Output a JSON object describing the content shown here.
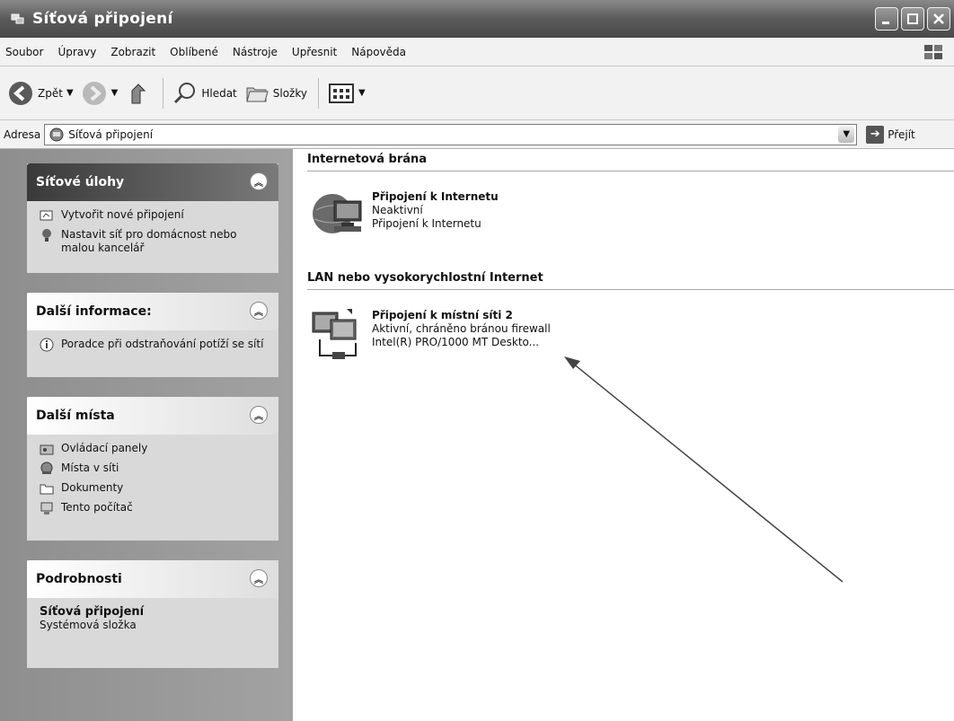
{
  "window": {
    "title": "Síťová připojení"
  },
  "menu": {
    "items": [
      "Soubor",
      "Úpravy",
      "Zobrazit",
      "Oblíbené",
      "Nástroje",
      "Upřesnit",
      "Nápověda"
    ]
  },
  "toolbar": {
    "back_label": "Zpět",
    "search_label": "Hledat",
    "folders_label": "Složky"
  },
  "address": {
    "label": "Adresa",
    "value": "Síťová připojení",
    "go_label": "Přejít"
  },
  "taskpane": {
    "network_tasks": {
      "title": "Síťové úlohy",
      "items": [
        "Vytvořit nové připojení",
        "Nastavit síť pro domácnost nebo malou kancelář"
      ]
    },
    "more_info": {
      "title": "Další informace:",
      "items": [
        "Poradce při odstraňování potíží se sítí"
      ]
    },
    "other_places": {
      "title": "Další místa",
      "items": [
        "Ovládací panely",
        "Místa v síti",
        "Dokumenty",
        "Tento počítač"
      ]
    },
    "details": {
      "title": "Podrobnosti",
      "name": "Síťová připojení",
      "type": "Systémová složka"
    }
  },
  "content": {
    "groups": [
      {
        "header": "Internetová brána",
        "connection": {
          "name": "Připojení k Internetu",
          "status": "Neaktivní",
          "device": "Připojení k Internetu"
        }
      },
      {
        "header": "LAN nebo vysokorychlostní Internet",
        "connection": {
          "name": "Připojení k místní síti 2",
          "status": "Aktivní, chráněno bránou firewall",
          "device": "Intel(R) PRO/1000 MT Deskto..."
        }
      }
    ]
  }
}
